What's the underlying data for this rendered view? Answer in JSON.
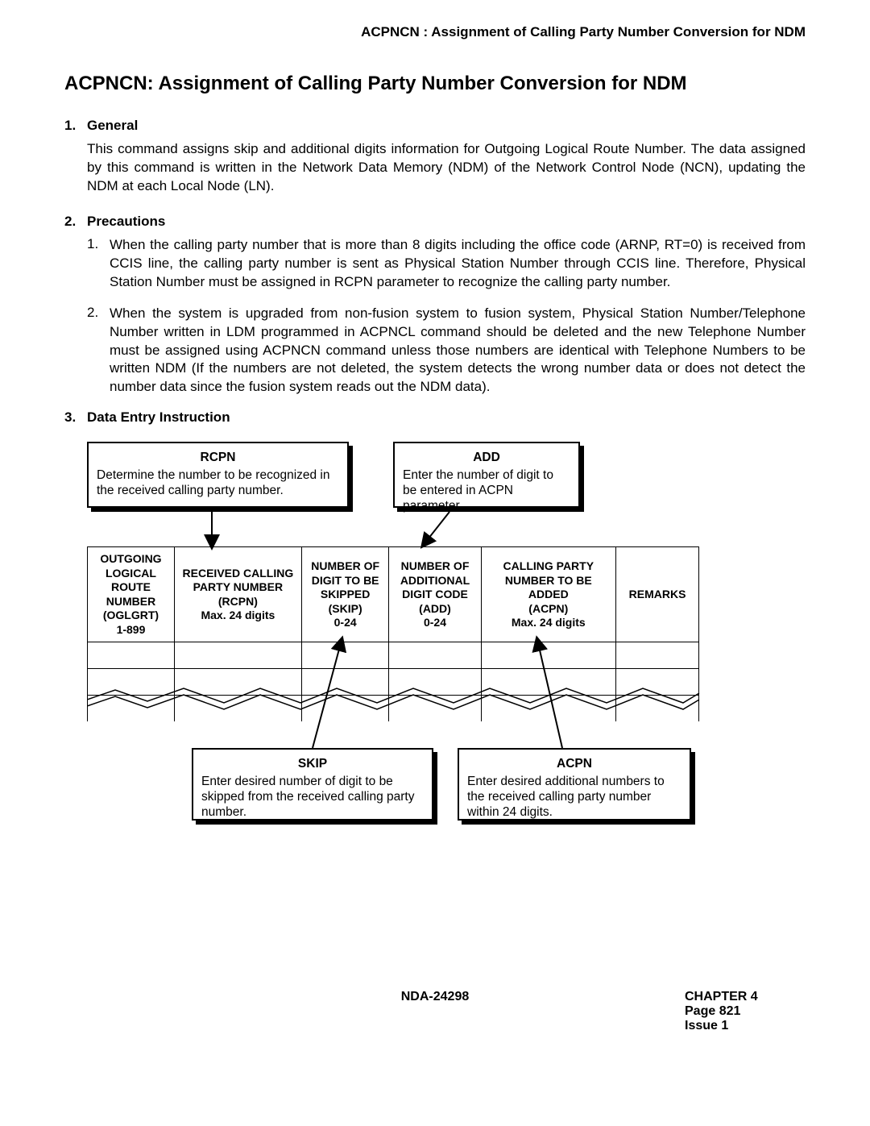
{
  "header": {
    "running_title": "ACPNCN : Assignment of Calling Party Number Conversion for NDM"
  },
  "title": "ACPNCN: Assignment of Calling Party Number Conversion for NDM",
  "s1": {
    "num": "1.",
    "label": "General",
    "text": "This command assigns skip and additional digits information for Outgoing Logical Route Number. The data assigned by this command is written in the Network Data Memory (NDM) of the Network Control Node (NCN), updating the NDM at each Local Node (LN)."
  },
  "s2": {
    "num": "2.",
    "label": "Precautions",
    "p1_num": "1.",
    "p1": "When the calling party number that is more than 8 digits including the office code (ARNP, RT=0) is received from CCIS line, the calling party number is sent as Physical Station Number through CCIS line. Therefore, Physical Station Number must be assigned in RCPN parameter to recognize the calling party number.",
    "p2_num": "2.",
    "p2": "When the system is upgraded from non-fusion system to fusion system, Physical Station Number/Telephone Number written in LDM programmed in ACPNCL command should be deleted and the new Telephone Number must be assigned using ACPNCN command unless those numbers are identical with Telephone Numbers to be written NDM (If the numbers are not deleted, the system detects the wrong number data or does not detect the number data since the fusion system reads out the NDM data)."
  },
  "s3": {
    "num": "3.",
    "label": "Data Entry Instruction"
  },
  "callouts": {
    "rcpn_title": "RCPN",
    "rcpn_text": "Determine the number to be recognized in the received calling party number.",
    "add_title": "ADD",
    "add_text": "Enter the number of digit to be entered in ACPN parameter.",
    "skip_title": "SKIP",
    "skip_text": "Enter desired number of digit to be skipped from the received calling party number.",
    "acpn_title": "ACPN",
    "acpn_text": "Enter desired additional numbers to the received calling party number within 24 digits."
  },
  "table": {
    "h1": "OUTGOING LOGICAL ROUTE NUMBER (OGLGRT) 1-899",
    "h2": "RECEIVED CALLING PARTY NUMBER (RCPN) Max. 24 digits",
    "h3": "NUMBER OF DIGIT TO BE SKIPPED (SKIP) 0-24",
    "h4": "NUMBER OF ADDITIONAL DIGIT CODE (ADD) 0-24",
    "h5": "CALLING PARTY NUMBER TO BE ADDED (ACPN) Max. 24 digits",
    "h6": "REMARKS"
  },
  "footer": {
    "center": "NDA-24298",
    "right1": "CHAPTER 4",
    "right2": "Page 821",
    "right3": "Issue 1"
  }
}
